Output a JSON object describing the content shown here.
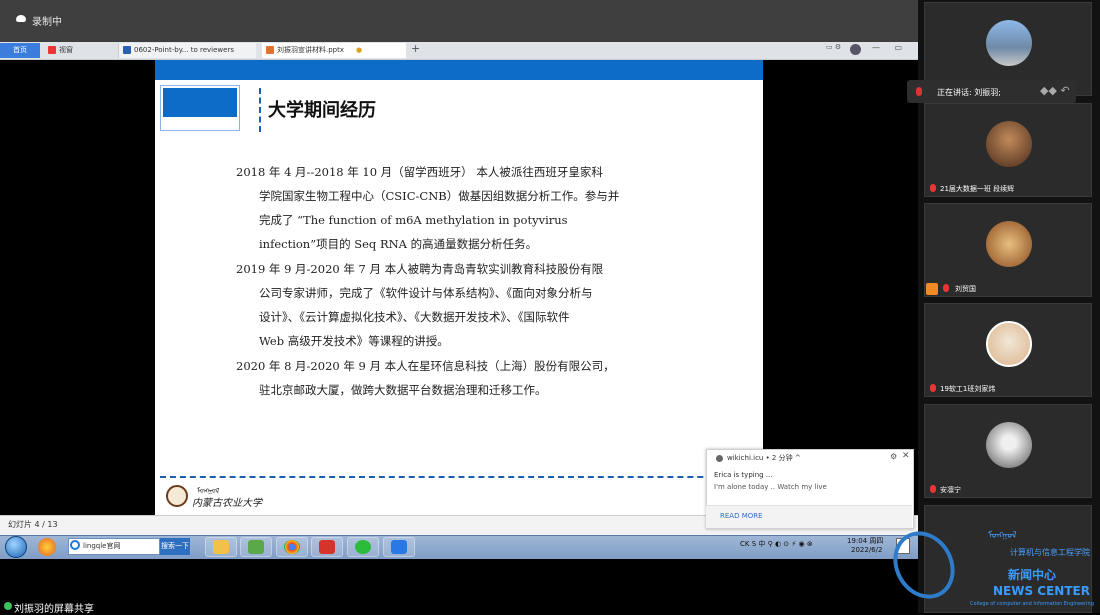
{
  "recording": {
    "label": "录制中"
  },
  "browser": {
    "tabs": [
      {
        "label": "首页"
      },
      {
        "label": "视窗"
      },
      {
        "label": "0602-Point-by... to reviewers"
      },
      {
        "label": "刘振羽宣讲材料.pptx"
      }
    ],
    "new_tab": "+"
  },
  "slide": {
    "title": "大学期间经历",
    "lines": [
      "2018 年 4 月--2018 年 10 月（留学西班牙） 本人被派往西班牙皇家科",
      "学院国家生物工程中心（CSIC-CNB）做基因组数据分析工作。参与并",
      "完成了 “The function of m6A methylation in potyvirus",
      "infection”项目的 Seq RNA 的高通量数据分析任务。",
      "2019 年 9 月-2020 年 7 月 本人被聘为青岛青软实训教育科技股份有限",
      "公司专家讲师，完成了《软件设计与体系结构》、《面向对象分析与",
      "设计》、《云计算虚拟化技术》、《大数据开发技术》、《国际软件",
      "Web 高级开发技术》等课程的讲授。",
      "2020 年 8 月-2020 年 9 月 本人在星环信息科技（上海）股份有限公司，",
      "驻北京邮政大厦，做跨大数据平台数据治理和迁移工作。"
    ],
    "university": "内蒙古农业大学",
    "counter": "幻灯片 4 / 13"
  },
  "notification": {
    "site": "wikichi.icu  •  2 分钟 ^",
    "line1": "Erica is typing ...",
    "line2": "I'm alone today .. Watch my live",
    "read_more": "READ MORE"
  },
  "taskbar": {
    "search_text": "lingqle官网",
    "search_button": "搜索一下",
    "tray": "CK  S  中  ⚲  ◐  ⊙  ⚡  ◉  ⊗",
    "time": "19:04 周四",
    "date": "2022/6/2"
  },
  "share": {
    "label": "刘振羽的屏幕共享"
  },
  "participants": {
    "speaking_label": "正在讲话: 刘振羽;",
    "names": [
      "21届大数据一班 段续辉",
      "刘贸国",
      "19软工1班刘家炜",
      "安凛宁"
    ]
  },
  "watermark": {
    "school": "计算机与信息工程学院",
    "cn": "新闻中心",
    "en": "NEWS CENTER",
    "sub": "College of computer and Information Engineering"
  }
}
